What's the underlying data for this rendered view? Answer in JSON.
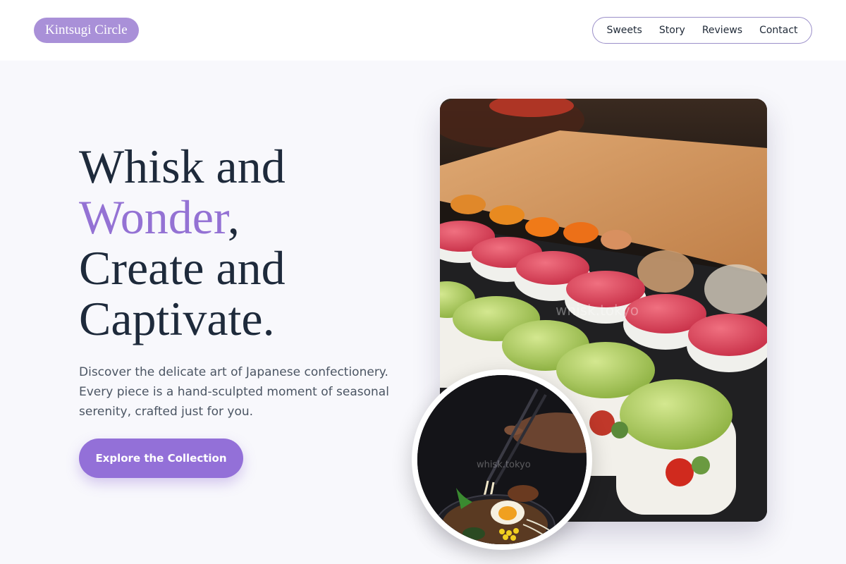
{
  "brand": {
    "name": "Kintsugi Circle",
    "accent_color": "#9472d4",
    "logo_bg": "#a990d8"
  },
  "nav": {
    "items": [
      {
        "label": "Sweets"
      },
      {
        "label": "Story"
      },
      {
        "label": "Reviews"
      },
      {
        "label": "Contact"
      }
    ]
  },
  "hero": {
    "headline_line1": "Whisk and",
    "headline_accent": "Wonder",
    "headline_comma": ",",
    "headline_line3": "Create and",
    "headline_line4": "Captivate.",
    "description": "Discover the delicate art of Japanese confectionery. Every piece is a hand-sculpted moment of seasonal serenity, crafted just for you.",
    "cta_label": "Explore the Collection"
  },
  "images": {
    "main_watermark": "whisk.tokyo",
    "inset_watermark": "whisk.tokyo",
    "main_subject": "sushi-rolls-photo",
    "inset_subject": "ramen-bowl-photo"
  }
}
